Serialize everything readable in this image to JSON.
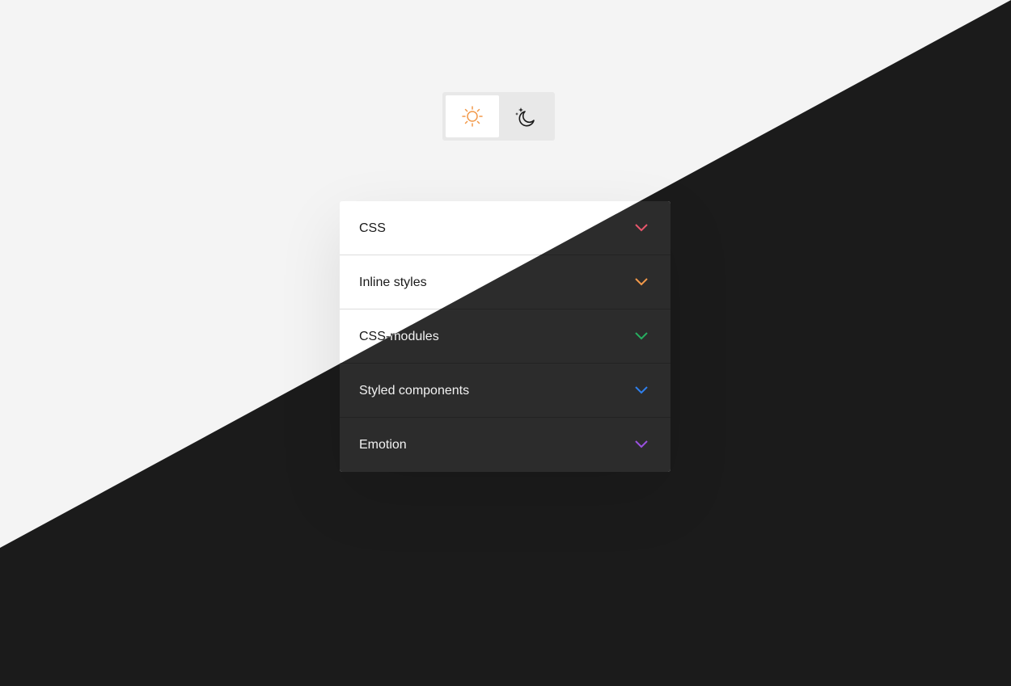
{
  "theme_toggle": {
    "options": [
      {
        "name": "light",
        "icon": "sun-icon",
        "selected": true
      },
      {
        "name": "dark",
        "icon": "moon-stars-icon",
        "selected": false
      }
    ]
  },
  "accordion": {
    "items": [
      {
        "label": "CSS",
        "chevron_color": "#e8566c"
      },
      {
        "label": "Inline styles",
        "chevron_color": "#f2994a"
      },
      {
        "label": "CSS-modules",
        "chevron_color": "#27ae60"
      },
      {
        "label": "Styled components",
        "chevron_color": "#2f80ed"
      },
      {
        "label": "Emotion",
        "chevron_color": "#9b51e0"
      }
    ]
  },
  "colors": {
    "light_bg": "#f4f4f4",
    "dark_bg": "#1b1b1b",
    "sun": "#f2994a"
  }
}
